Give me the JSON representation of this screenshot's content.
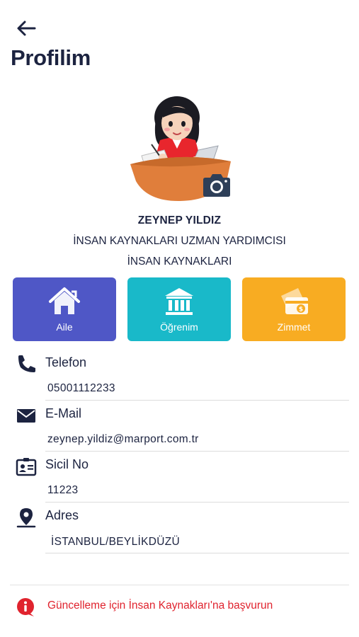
{
  "header": {
    "back_icon": "arrow-left-icon",
    "title": "Profilim"
  },
  "profile": {
    "avatar_icon": "woman-at-desk-avatar",
    "camera_icon": "camera-icon",
    "name": "ZEYNEP YILDIZ",
    "job_title": "İNSAN KAYNAKLARI UZMAN YARDIMCISI",
    "department": "İNSAN KAYNAKLARI"
  },
  "tiles": [
    {
      "label": "Aile",
      "icon": "home-icon",
      "color": "#4f57c6"
    },
    {
      "label": "Öğrenim",
      "icon": "institution-icon",
      "color": "#19b9c9"
    },
    {
      "label": "Zimmet",
      "icon": "money-card-icon",
      "color": "#f8ac22"
    }
  ],
  "info": {
    "phone": {
      "label": "Telefon",
      "value": "05001112233",
      "icon": "phone-icon"
    },
    "email": {
      "label": "E-Mail",
      "value": "zeynep.yildiz@marport.com.tr",
      "icon": "envelope-icon"
    },
    "registry": {
      "label": "Sicil No",
      "value": "11223",
      "icon": "id-card-icon"
    },
    "address": {
      "label": "Adres",
      "value": "İSTANBUL/BEYLİKDÜZÜ",
      "icon": "map-pin-icon"
    }
  },
  "notice": {
    "icon": "info-circle-icon",
    "text": "Güncelleme için İnsan Kaynakları'na başvurun",
    "color": "#e0232e"
  },
  "colors": {
    "primary_text": "#1c2340",
    "divider": "#dcdcdc"
  }
}
